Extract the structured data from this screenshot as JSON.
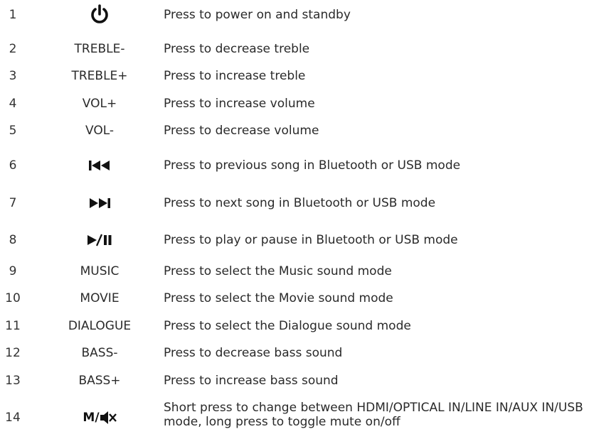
{
  "rows": [
    {
      "num": "1",
      "key": "",
      "icon": "power-icon",
      "desc": "Press to power on and standby"
    },
    {
      "num": "2",
      "key": "TREBLE-",
      "desc": "Press to decrease treble"
    },
    {
      "num": "3",
      "key": "TREBLE+",
      "desc": "Press to increase treble"
    },
    {
      "num": "4",
      "key": "VOL+",
      "desc": "Press to increase volume"
    },
    {
      "num": "5",
      "key": "VOL-",
      "desc": "Press to decrease volume"
    },
    {
      "num": "6",
      "key": "",
      "icon": "previous-track-icon",
      "desc": "Press to previous song in Bluetooth or USB mode"
    },
    {
      "num": "7",
      "key": "",
      "icon": "next-track-icon",
      "desc": "Press to next song in Bluetooth or USB mode"
    },
    {
      "num": "8",
      "key": "",
      "icon": "play-pause-icon",
      "desc": "Press to play or pause in Bluetooth or USB mode"
    },
    {
      "num": "9",
      "key": "MUSIC",
      "desc": "Press to select the Music sound mode"
    },
    {
      "num": "10",
      "key": "MOVIE",
      "desc": "Press to select the Movie sound mode"
    },
    {
      "num": "11",
      "key": "DIALOGUE",
      "desc": "Press to select the Dialogue sound mode"
    },
    {
      "num": "12",
      "key": "BASS-",
      "desc": "Press to decrease bass sound"
    },
    {
      "num": "13",
      "key": "BASS+",
      "desc": "Press to increase bass sound"
    },
    {
      "num": "14",
      "key": "M/",
      "icon": "mute-speaker-icon",
      "desc": "Short press to change between HDMI/OPTICAL IN/LINE IN/AUX IN/USB mode, long press to toggle mute on/off"
    }
  ]
}
